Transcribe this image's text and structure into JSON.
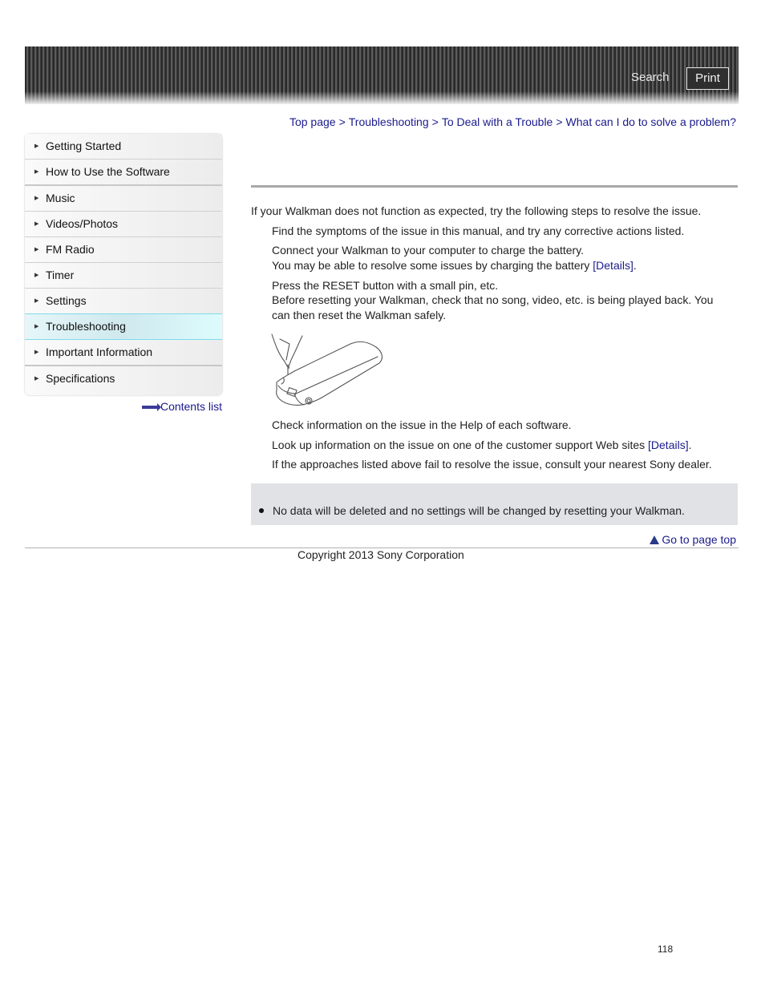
{
  "header": {
    "search_label": "Search",
    "print_label": "Print"
  },
  "breadcrumb": [
    {
      "label": "Top page"
    },
    {
      "label": "Troubleshooting"
    },
    {
      "label": "To Deal with a Trouble"
    },
    {
      "label": "What can I do to solve a problem?"
    }
  ],
  "breadcrumb_separator": ">",
  "sidebar": {
    "items": [
      {
        "label": "Getting Started"
      },
      {
        "label": "How to Use the Software"
      },
      {
        "label": "Music"
      },
      {
        "label": "Videos/Photos"
      },
      {
        "label": "FM Radio"
      },
      {
        "label": "Timer"
      },
      {
        "label": "Settings"
      },
      {
        "label": "Troubleshooting",
        "active": true
      },
      {
        "label": "Important Information"
      },
      {
        "label": "Specifications"
      }
    ],
    "contents_list_label": "Contents list"
  },
  "main": {
    "intro": "If your Walkman does not function as expected, try the following steps to resolve the issue.",
    "step1": "Find the symptoms of the issue in this manual, and try any corrective actions listed.",
    "step2_line1": "Connect your Walkman to your computer to charge the battery.",
    "step2_line2": "You may be able to resolve some issues by charging the battery ",
    "step2_link": "[Details]",
    "step3_line1": "Press the RESET button with a small pin, etc.",
    "step3_line2": "Before resetting your Walkman, check that no song, video, etc. is being played back. You",
    "step3_line3": "can then reset the Walkman safely.",
    "step4": "Check information on the issue in the Help of each software.",
    "step5": "Look up information on the issue on one of the customer support Web sites ",
    "step5_link": "[Details]",
    "step6": "If the approaches listed above fail to resolve the issue, consult your nearest Sony dealer.",
    "note": "No data will be deleted and no settings will be changed by resetting your Walkman.",
    "illustration": "reset-button-pin-illustration"
  },
  "footer": {
    "page_top_label": "Go to page top",
    "copyright": "Copyright 2013 Sony Corporation",
    "page_number": "118"
  },
  "colors": {
    "link": "#1a1a8c",
    "active_nav": "#cfe9ee",
    "note_bg": "#e0e2e6"
  }
}
